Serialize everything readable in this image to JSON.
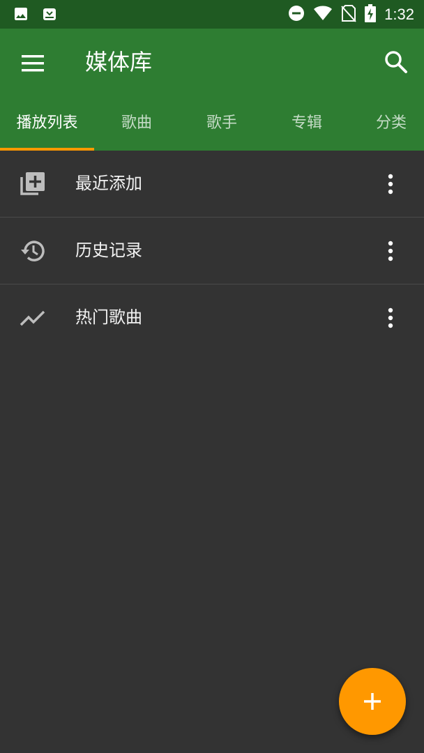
{
  "status_bar": {
    "time": "1:32",
    "left_icons": [
      "image-icon",
      "shop-icon"
    ],
    "right_icons": [
      "do-not-disturb-icon",
      "wifi-icon",
      "no-sim-icon",
      "battery-charging-icon"
    ]
  },
  "app_bar": {
    "title": "媒体库",
    "menu_icon": "menu-icon",
    "search_icon": "search-icon",
    "background_color": "#2e7d32",
    "status_bar_color": "#1f5a22"
  },
  "tabs": [
    {
      "label": "播放列表",
      "active": true
    },
    {
      "label": "歌曲",
      "active": false
    },
    {
      "label": "歌手",
      "active": false
    },
    {
      "label": "专辑",
      "active": false
    },
    {
      "label": "分类",
      "active": false
    }
  ],
  "accent_color": "#ff9800",
  "playlists": [
    {
      "label": "最近添加",
      "icon": "playlist-add-icon"
    },
    {
      "label": "历史记录",
      "icon": "history-icon"
    },
    {
      "label": "热门歌曲",
      "icon": "trending-icon"
    }
  ],
  "fab": {
    "icon": "add-icon"
  }
}
